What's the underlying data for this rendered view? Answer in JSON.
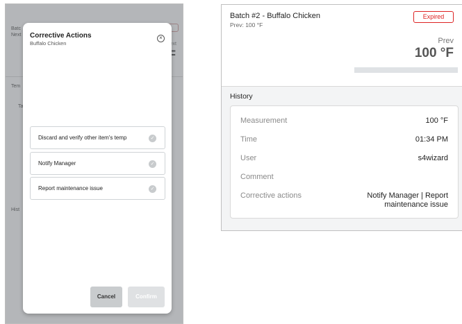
{
  "background": {
    "batch_label": "Batc",
    "next_label": "Next",
    "badge": "ed",
    "right_label": "ext",
    "big_temp": "F",
    "temp_label": "Tem",
    "row_label": "Ta",
    "history_label": "Hist"
  },
  "modal": {
    "title": "Corrective Actions",
    "subtitle": "Buffalo Chicken",
    "options": [
      {
        "label": "Discard and verify other item's temp"
      },
      {
        "label": "Notify Manager"
      },
      {
        "label": "Report maintenance issue"
      }
    ],
    "cancel_label": "Cancel",
    "confirm_label": "Confirm"
  },
  "detail": {
    "title": "Batch #2 - Buffalo Chicken",
    "prev_small": "Prev: 100 °F",
    "status_badge": "Expired",
    "prev_label": "Prev",
    "prev_value": "100 °F",
    "history_title": "History",
    "rows": [
      {
        "label": "Measurement",
        "value": "100 °F"
      },
      {
        "label": "Time",
        "value": "01:34 PM"
      },
      {
        "label": "User",
        "value": "s4wizard"
      },
      {
        "label": "Comment",
        "value": ""
      },
      {
        "label": "Corrective actions",
        "value": "Notify Manager | Report maintenance issue"
      }
    ]
  },
  "colors": {
    "expired": "#dd2222",
    "overlay": "#5a5f64"
  }
}
